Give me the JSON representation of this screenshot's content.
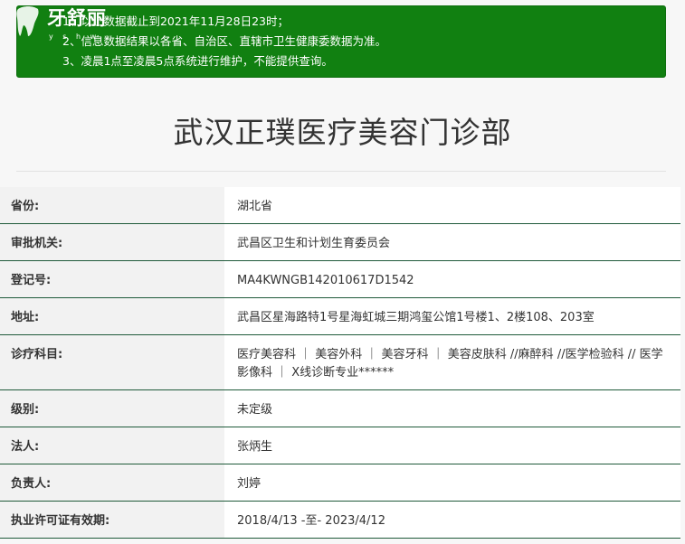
{
  "notice": {
    "line1": "1、以上数据截止到2021年11月28日23时；",
    "line2": "2、信息数据结果以各省、自治区、直辖市卫生健康委数据为准。",
    "line3": "3、凌晨1点至凌晨5点系统进行维护，不能提供查询。",
    "color": "#118011"
  },
  "watermark": {
    "text": "牙舒丽",
    "sub": "y s h w"
  },
  "page_title": "武汉正璞医疗美容门诊部",
  "rows": [
    {
      "label": "省份:",
      "value": "湖北省"
    },
    {
      "label": "审批机关:",
      "value": "武昌区卫生和计划生育委员会"
    },
    {
      "label": "登记号:",
      "value": "MA4KWNGB142010617D1542"
    },
    {
      "label": "地址:",
      "value": "武昌区星海路特1号星海虹城三期鸿玺公馆1号楼1、2楼108、203室"
    },
    {
      "label": "诊疗科目:",
      "value": "医疗美容科 ｜ 美容外科 ｜ 美容牙科 ｜ 美容皮肤科 //麻醉科 //医学检验科 // 医学影像科 ｜ X线诊断专业******"
    },
    {
      "label": "级别:",
      "value": "未定级"
    },
    {
      "label": "法人:",
      "value": "张炳生"
    },
    {
      "label": "负责人:",
      "value": "刘婷"
    },
    {
      "label": "执业许可证有效期:",
      "value": "2018/4/13 -至- 2023/4/12"
    }
  ]
}
